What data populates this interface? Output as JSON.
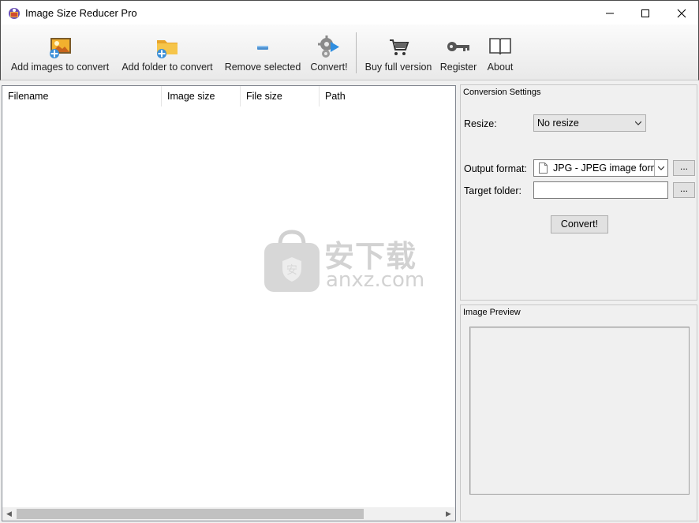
{
  "window": {
    "title": "Image Size Reducer Pro"
  },
  "toolbar": {
    "add_images": "Add images to convert",
    "add_folder": "Add folder to convert",
    "remove_selected": "Remove selected",
    "convert": "Convert!",
    "buy": "Buy full version",
    "register": "Register",
    "about": "About"
  },
  "file_list": {
    "columns": [
      "Filename",
      "Image size",
      "File size",
      "Path"
    ]
  },
  "conversion_settings": {
    "title": "Conversion Settings",
    "resize_label": "Resize:",
    "resize_value": "No resize",
    "output_format_label": "Output format:",
    "output_format_value": "JPG - JPEG image form",
    "target_folder_label": "Target folder:",
    "target_folder_value": "",
    "browse_label": "...",
    "convert_button": "Convert!"
  },
  "image_preview": {
    "title": "Image Preview"
  },
  "watermark": {
    "text_cn": "安下载",
    "text_en": "anxz.com"
  },
  "colors": {
    "title_bg": "#ffffff",
    "toolbar_bg": "#f3f3f3",
    "panel_bg": "#f0f0f0",
    "list_bg": "#ffffff"
  }
}
